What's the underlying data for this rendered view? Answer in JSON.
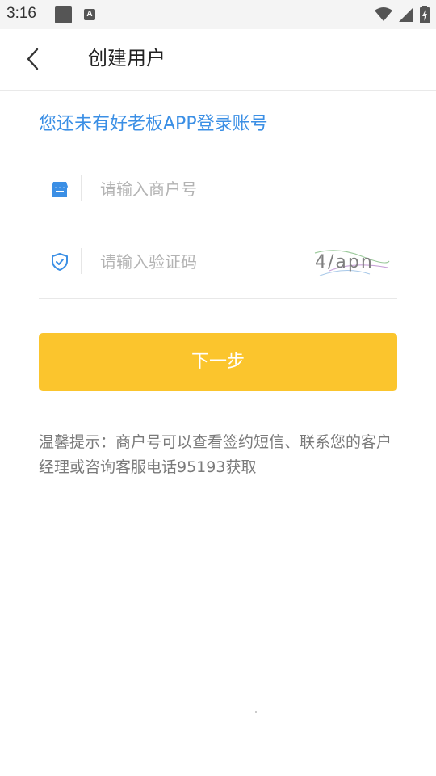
{
  "status_bar": {
    "time": "3:16",
    "notification_icons": [
      "square-notification-icon",
      "a-notification-icon"
    ],
    "right_icons": [
      "wifi-icon",
      "cell-signal-icon",
      "battery-charging-icon"
    ]
  },
  "header": {
    "title": "创建用户",
    "back_icon": "chevron-left-icon"
  },
  "notice": "您还未有好老板APP登录账号",
  "form": {
    "merchant": {
      "icon": "store-icon",
      "placeholder": "请输入商户号",
      "value": ""
    },
    "captcha": {
      "icon": "shield-check-icon",
      "placeholder": "请输入验证码",
      "value": "",
      "captcha_text": "4/apn"
    }
  },
  "next_button": {
    "label": "下一步",
    "color": "#fbc52d"
  },
  "tip": "温馨提示：商户号可以查看签约短信、联系您的客户经理或咨询客服电话95193获取",
  "colors": {
    "accent_blue": "#3b8fe5",
    "button_yellow": "#fbc52d"
  }
}
